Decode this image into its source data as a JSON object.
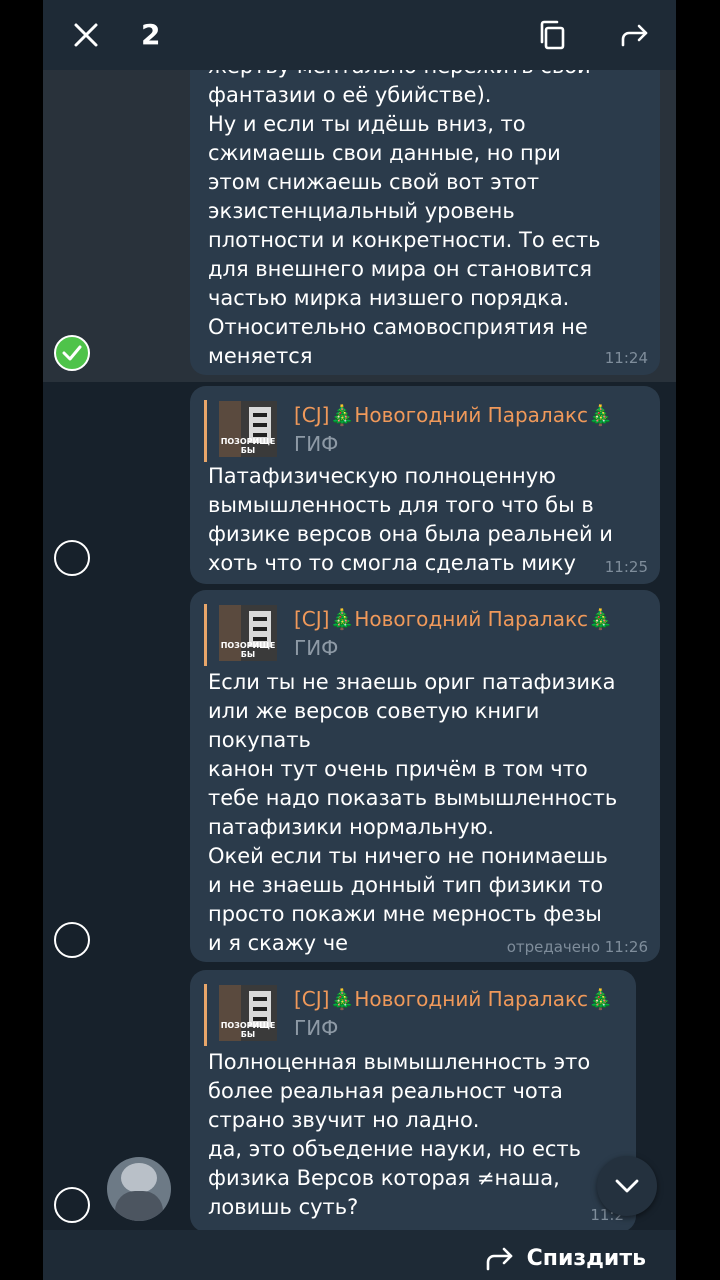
{
  "header": {
    "selected_count": "2",
    "close_icon": "close-icon",
    "copy_icon": "copy-icon",
    "forward_icon": "forward-icon"
  },
  "messages": [
    {
      "selected": true,
      "has_reply": false,
      "text": "жертву ментально пережить свои\nфантазии о её убийстве).\nНу и если ты идёшь вниз, то\nсжимаешь свои данные, но при\nэтом снижаешь свой вот этот\nэкзистенциальный уровень\nплотности и конкретности. То есть\nдля внешнего мира он становится\nчастью мирка низшего порядка.\nОтносительно самовосприятия не\nменяется",
      "time": "11:24"
    },
    {
      "selected": false,
      "has_reply": true,
      "reply_name": "[CJ]🎄Новогодний Паралакс🎄",
      "reply_type": "ГИФ",
      "reply_thumb_caption": "ПОЗОРИЩЕ БЫ",
      "text": "Патафизическую полноценную\nвымышленность для того что бы в\nфизике версов она была реальней и\nхоть что то смогла сделать мику",
      "time": "11:25"
    },
    {
      "selected": false,
      "has_reply": true,
      "reply_name": "[CJ]🎄Новогодний Паралакс🎄",
      "reply_type": "ГИФ",
      "reply_thumb_caption": "ПОЗОРИЩЕ БЫ",
      "text": "Если ты не знаешь ориг патафизика\nили же версов советую книги\nпокупать\nканон тут очень причём в том что\nтебе надо показать вымышленность\nпатафизики нормальную.\nОкей если ты ничего не понимаешь\nи не знаешь донный тип физики то\nпросто покажи мне мерность фезы\nи я скажу че",
      "time": "отредачено 11:26"
    },
    {
      "selected": false,
      "has_reply": true,
      "reply_name": "[CJ]🎄Новогодний Паралакс🎄",
      "reply_type": "ГИФ",
      "reply_thumb_caption": "ПОЗОРИЩЕ БЫ",
      "text": "Полноценная вымышленность это\nболее реальная реальност чота\nстрано звучит но ладно.\nда, это объедение науки, но есть\nфизика Версов которая ≠наша,\nловишь суть?",
      "time": "11:2"
    }
  ],
  "bottom": {
    "action_label": "Спиздить",
    "action_icon": "reply-arrow-icon"
  },
  "colors": {
    "background": "#17212b",
    "bubble": "#2b3b4b",
    "reply_name": "#f0995a",
    "check_selected": "#4fc34a"
  }
}
